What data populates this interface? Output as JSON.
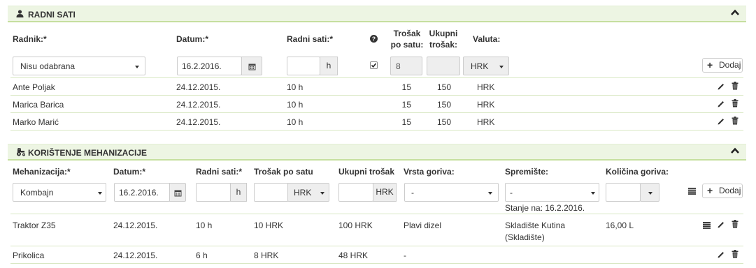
{
  "radni_sati": {
    "title": "RADNI SATI",
    "headers": {
      "radnik": "Radnik:*",
      "datum": "Datum:*",
      "radni_sati": "Radni sati:*",
      "trosak_l1": "Trošak",
      "trosak_l2": "po satu:",
      "ukupni_l1": "Ukupni",
      "ukupni_l2": "trošak:",
      "valuta": "Valuta:"
    },
    "form": {
      "radnik_value": "Nisu odabrana",
      "datum_value": "16.2.2016.",
      "sati_value": "",
      "sati_unit": "h",
      "checkbox_checked": true,
      "trosak_value": "8",
      "ukupni_value": "",
      "valuta_value": "HRK",
      "add_label": "Dodaj"
    },
    "rows": [
      {
        "radnik": "Ante Poljak",
        "datum": "24.12.2015.",
        "sati": "10 h",
        "trosak": "15",
        "ukupni": "150",
        "valuta": "HRK"
      },
      {
        "radnik": "Marica Barica",
        "datum": "24.12.2015.",
        "sati": "10 h",
        "trosak": "15",
        "ukupni": "150",
        "valuta": "HRK"
      },
      {
        "radnik": "Marko Marić",
        "datum": "24.12.2015.",
        "sati": "10 h",
        "trosak": "15",
        "ukupni": "150",
        "valuta": "HRK"
      }
    ]
  },
  "mehanizacija": {
    "title": "KORIŠTENJE MEHANIZACIJE",
    "headers": {
      "mehanizacija": "Mehanizacija:*",
      "datum": "Datum:*",
      "radni_sati": "Radni sati:*",
      "trosak": "Trošak po satu",
      "ukupni": "Ukupni trošak",
      "gorivo": "Vrsta goriva:",
      "spremiste": "Spremište:",
      "kolicina": "Količina goriva:"
    },
    "form": {
      "mehanizacija_value": "Kombajn",
      "datum_value": "16.2.2016.",
      "sati_value": "",
      "sati_unit": "h",
      "trosak_value": "",
      "trosak_currency": "HRK",
      "ukupni_value": "",
      "ukupni_currency": "HRK",
      "gorivo_value": "-",
      "spremiste_value": "-",
      "stanje_na": "Stanje na: 16.2.2016.",
      "kolicina_value": "",
      "add_label": "Dodaj"
    },
    "rows": [
      {
        "naziv": "Traktor Z35",
        "datum": "24.12.2015.",
        "sati": "10 h",
        "trosak": "10 HRK",
        "ukupni": "100 HRK",
        "gorivo": "Plavi dizel",
        "spremiste_l1": "Skladište Kutina",
        "spremiste_l2": "(Skladište)",
        "kolicina": "16,00 L"
      },
      {
        "naziv": "Prikolica",
        "datum": "24.12.2015.",
        "sati": "6 h",
        "trosak": "8 HRK",
        "ukupni": "48 HRK",
        "gorivo": "-",
        "spremiste_l1": "",
        "spremiste_l2": "",
        "kolicina": ""
      }
    ]
  },
  "icons": {
    "user": "user-icon",
    "tractor": "tractor-icon",
    "chevron": "chevron-up-icon",
    "calendar": "calendar-icon",
    "help": "question-circle-icon",
    "edit": "pencil-icon",
    "delete": "trash-icon",
    "list": "list-icon",
    "plus": "plus-icon"
  },
  "colors": {
    "section_bg": "#edf5e3",
    "section_border": "#c6df9f",
    "row_border": "#d9e8c4"
  }
}
